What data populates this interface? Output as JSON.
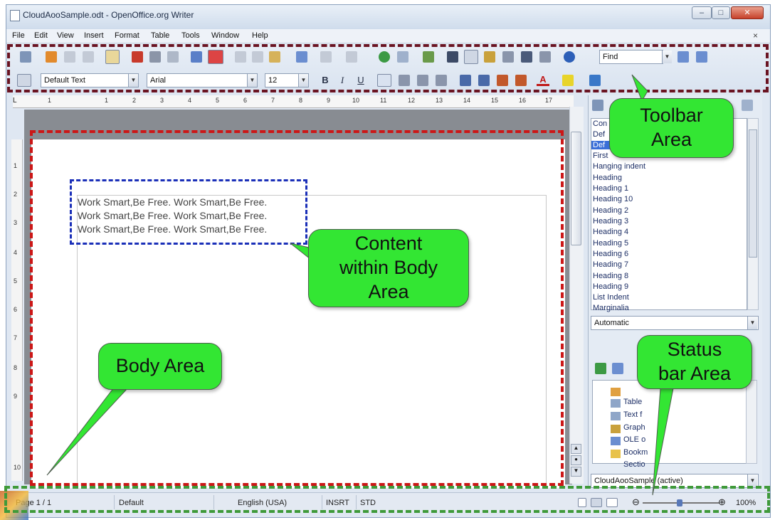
{
  "window": {
    "title": "CloudAooSample.odt - OpenOffice.org Writer",
    "minimize_icon": "minimize-icon",
    "maximize_icon": "maximize-icon",
    "close_icon": "close-icon"
  },
  "menubar": {
    "items": [
      "File",
      "Edit",
      "View",
      "Insert",
      "Format",
      "Table",
      "Tools",
      "Window",
      "Help"
    ],
    "close_doc": "×"
  },
  "toolbar": {
    "find_placeholder": "Find",
    "paragraph_style": "Default Text",
    "font_name": "Arial",
    "font_size": "12",
    "bold": "B",
    "italic": "I",
    "underline": "U",
    "font_color_glyph": "A"
  },
  "ruler": {
    "numbers": [
      "1",
      "1",
      "2",
      "3",
      "4",
      "5",
      "6",
      "7",
      "8",
      "9",
      "10",
      "11",
      "12",
      "13",
      "14",
      "15",
      "16",
      "17"
    ],
    "vertical_numbers": [
      "1",
      "2",
      "3",
      "4",
      "5",
      "6",
      "7",
      "8",
      "9",
      "10"
    ]
  },
  "document": {
    "lines": [
      "Work Smart,Be Free. Work Smart,Be Free.",
      "Work Smart,Be Free. Work Smart,Be Free.",
      "Work Smart,Be Free. Work Smart,Be Free."
    ]
  },
  "styles_panel": {
    "items": [
      "Con",
      "Def",
      "Def",
      "First",
      "Hanging indent",
      "Heading",
      "Heading 1",
      "Heading 10",
      "Heading 2",
      "Heading 3",
      "Heading 4",
      "Heading 5",
      "Heading 6",
      "Heading 7",
      "Heading 8",
      "Heading 9",
      "List Indent",
      "Marginalia"
    ],
    "filter": "Automatic"
  },
  "navigator": {
    "items": [
      "Table",
      "Text f",
      "Graph",
      "OLE o",
      "Bookm",
      "Sectio"
    ],
    "document": "CloudAooSample (active)"
  },
  "statusbar": {
    "page": "Page 1 / 1",
    "style": "Default",
    "language": "English (USA)",
    "insert_mode": "INSRT",
    "selection_mode": "STD",
    "zoom": "100%",
    "zoom_minus": "⊖",
    "zoom_plus": "⊕",
    "zoom_level_percent": 100
  },
  "annotations": {
    "toolbar_area": "Toolbar\nArea",
    "content_area": "Content\nwithin Body\nArea",
    "body_area": "Body Area",
    "status_area": "Status\nbar Area"
  },
  "colors": {
    "toolbar_border": "#6a1422",
    "body_border": "#cc1717",
    "content_border": "#1a2fb8",
    "status_border": "#3f9a3a",
    "callout_fill": "#33e633"
  }
}
